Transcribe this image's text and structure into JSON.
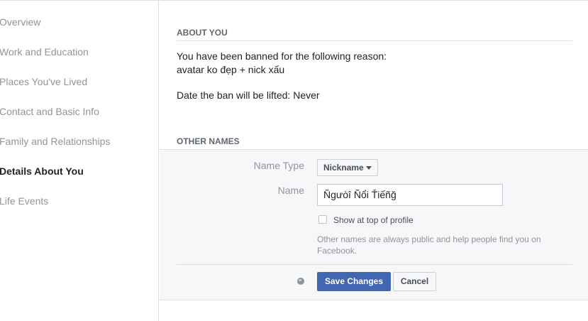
{
  "sidebar": {
    "items": [
      {
        "label": "Overview"
      },
      {
        "label": "Work and Education"
      },
      {
        "label": "Places You've Lived"
      },
      {
        "label": "Contact and Basic Info"
      },
      {
        "label": "Family and Relationships"
      },
      {
        "label": "Details About You",
        "active": true
      },
      {
        "label": "Life Events"
      }
    ]
  },
  "about": {
    "heading": "ABOUT YOU",
    "ban_line1": "You have been banned for the following reason:",
    "ban_reason": "avatar ko đẹp + nick xấu",
    "lift_date": "Date the ban will be lifted: Never"
  },
  "other_names": {
    "heading": "OTHER NAMES",
    "name_type_label": "Name Type",
    "name_type_value": "Nickname",
    "name_label": "Name",
    "name_value": "Ñgưòî Ñổi Ťiếñğ",
    "checkbox_label": "Show at top of profile",
    "checkbox_checked": false,
    "help_text": "Other names are always public and help people find you on Facebook.",
    "save_label": "Save Changes",
    "cancel_label": "Cancel",
    "privacy_icon": "globe-icon"
  }
}
